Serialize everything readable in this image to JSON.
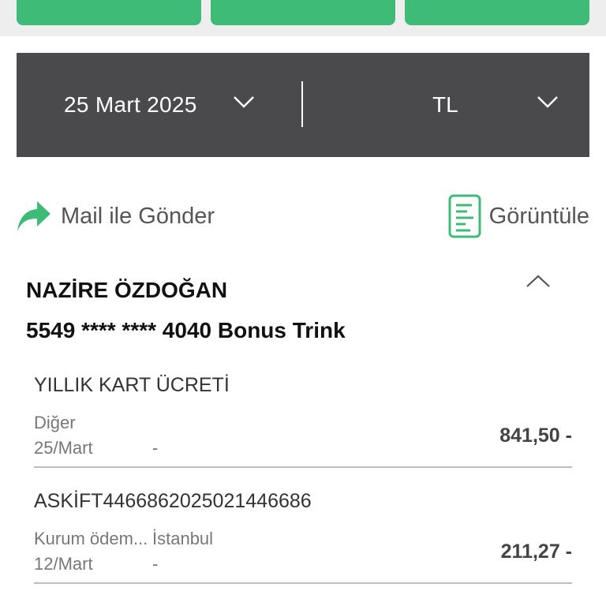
{
  "top_tabs": [
    {
      "name": "top-tab-1"
    },
    {
      "name": "top-tab-2"
    },
    {
      "name": "top-tab-3"
    }
  ],
  "filter": {
    "date": "25 Mart 2025",
    "currency": "TL"
  },
  "actions": {
    "mail_label": "Mail ile Gönder",
    "view_label": "Görüntüle"
  },
  "account": {
    "holder": "NAZİRE ÖZDOĞAN",
    "card": "5549 **** **** 4040 Bonus Trink"
  },
  "transactions": [
    {
      "title": "YILLIK KART ÜCRETİ",
      "category": "Diğer",
      "city": "",
      "date": "25/Mart",
      "dash": "-",
      "amount": "841,50 -"
    },
    {
      "title": "ASKİFT4466862025021446686",
      "category": "Kurum ödem...",
      "city": "İstanbul",
      "date": "12/Mart",
      "dash": "-",
      "amount": "211,27 -"
    }
  ],
  "colors": {
    "accent": "#3dbb77",
    "filter_bg": "#4a494c"
  },
  "icons": [
    "share-arrow-icon",
    "document-icon",
    "chevron-down-icon",
    "chevron-up-icon"
  ]
}
